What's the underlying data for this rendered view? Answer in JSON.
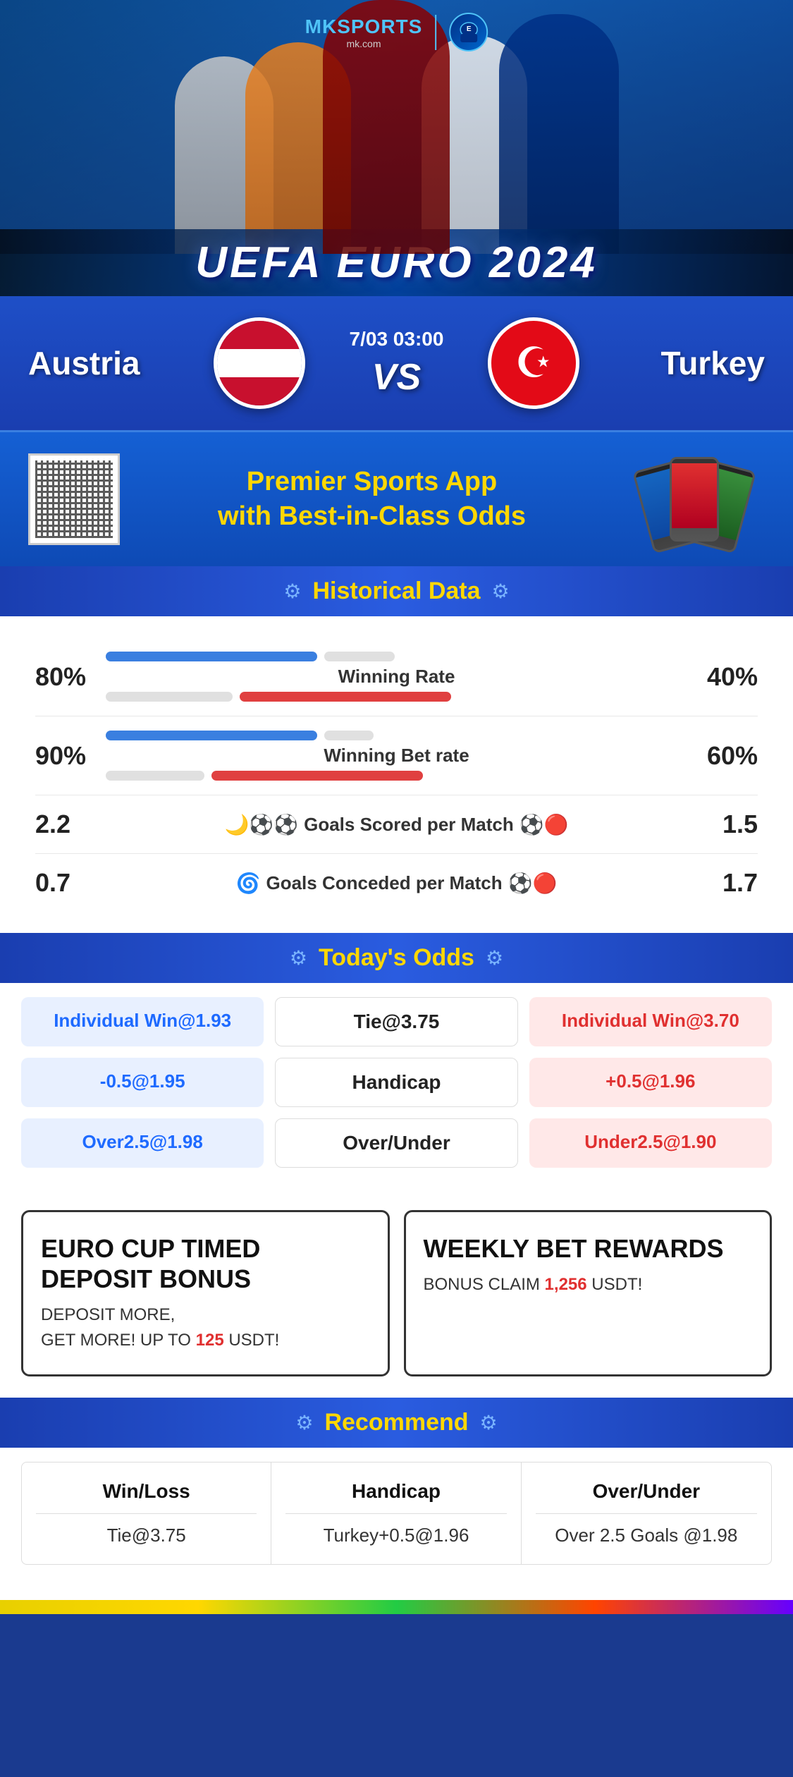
{
  "brand": {
    "name": "MK",
    "sports": "SPORTS",
    "domain": "mk.com",
    "logo_unicode": "⚽"
  },
  "header": {
    "event": "UEFA EURO 2024"
  },
  "match": {
    "team_left": "Austria",
    "team_right": "Turkey",
    "date_time": "7/03 03:00",
    "vs": "VS"
  },
  "promo": {
    "title_line1": "Premier Sports App",
    "title_line2": "with Best-in-Class Odds"
  },
  "historical": {
    "section_title": "Historical Data",
    "winning_rate": {
      "label": "Winning Rate",
      "left_value": "80%",
      "right_value": "40%",
      "left_pct": 80,
      "right_pct": 40
    },
    "winning_bet": {
      "label": "Winning Bet rate",
      "left_value": "90%",
      "right_value": "60%",
      "left_pct": 90,
      "right_pct": 60
    },
    "goals_scored": {
      "label": "Goals Scored per Match",
      "left_value": "2.2",
      "right_value": "1.5"
    },
    "goals_conceded": {
      "label": "Goals Conceded per Match",
      "left_value": "0.7",
      "right_value": "1.7"
    }
  },
  "odds": {
    "section_title": "Today's Odds",
    "rows": [
      {
        "left": "Individual Win@1.93",
        "center": "Tie@3.75",
        "right": "Individual Win@3.70"
      },
      {
        "left": "-0.5@1.95",
        "center": "Handicap",
        "right": "+0.5@1.96"
      },
      {
        "left": "Over2.5@1.98",
        "center": "Over/Under",
        "right": "Under2.5@1.90"
      }
    ]
  },
  "bonus": {
    "left_title": "EURO CUP TIMED DEPOSIT BONUS",
    "left_desc_line1": "DEPOSIT MORE,",
    "left_desc_line2": "GET MORE! UP TO",
    "left_highlight": "125",
    "left_currency": "USDT!",
    "right_title": "WEEKLY BET REWARDS",
    "right_desc": "BONUS CLAIM",
    "right_highlight": "1,256",
    "right_currency": "USDT!"
  },
  "recommend": {
    "section_title": "Recommend",
    "cols": [
      {
        "header": "Win/Loss",
        "value": "Tie@3.75"
      },
      {
        "header": "Handicap",
        "value": "Turkey+0.5@1.96"
      },
      {
        "header": "Over/Under",
        "value": "Over 2.5 Goals @1.98"
      }
    ]
  }
}
